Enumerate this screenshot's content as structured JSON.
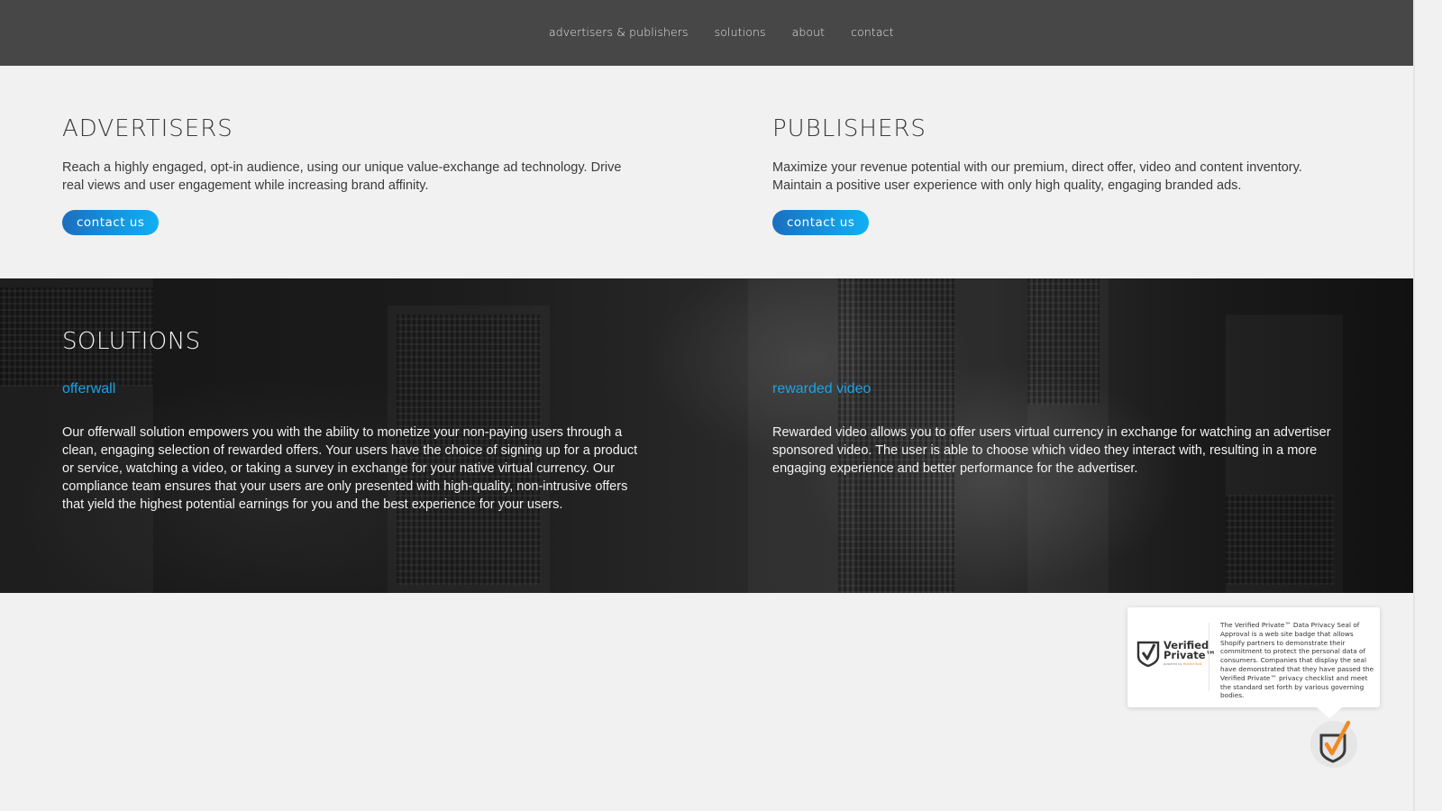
{
  "nav": {
    "items": [
      {
        "label": "advertisers & publishers"
      },
      {
        "label": "solutions"
      },
      {
        "label": "about"
      },
      {
        "label": "contact"
      }
    ]
  },
  "advertisers": {
    "title": "ADVERTISERS",
    "description": "Reach a highly engaged, opt-in audience, using our unique value-exchange ad technology. Drive real views and user engagement while increasing brand affinity.",
    "button_label": "contact us"
  },
  "publishers": {
    "title": "PUBLISHERS",
    "description": "Maximize your revenue potential with our premium, direct offer, video and content inventory. Maintain a positive user experience with only high quality, engaging branded ads.",
    "button_label": "contact us"
  },
  "solutions": {
    "title": "SOLUTIONS",
    "items": [
      {
        "title": "offerwall",
        "description": "Our offerwall solution empowers you with the ability to monetize your non-paying users through a clean, engaging selection of rewarded offers. Your users have the choice of signing up for a product or service, watching a video, or taking a survey in exchange for your native virtual currency. Our compliance team ensures that your users are only presented with high-quality, non-intrusive offers that yield the highest potential earnings for you and the best experience for your users."
      },
      {
        "title": "rewarded video",
        "description": "Rewarded video allows you to offer users virtual currency in exchange for watching an advertiser sponsored video. The user is able to choose which video they interact with, resulting in a more engaging experience and better performance for the advertiser."
      }
    ]
  },
  "verified_private": {
    "logo_line1": "Verified",
    "logo_line2": "Private™",
    "powered_by": "powered by",
    "powered_brand": "HiddenTrust",
    "description": "The Verified Private™ Data Privacy Seal of Approval is a web site badge that allows Shopify partners to demonstrate their commitment to protect the personal data of consumers. Companies that display the seal have demonstrated that they have passed the Verified Private™ privacy checklist and meet the standard set forth by various governing bodies.",
    "badge_icon": "shield-check-icon"
  },
  "colors": {
    "nav_bg": "#474747",
    "accent_blue": "#1aa3e8",
    "button_gradient_start": "#1a6fbf",
    "button_gradient_end": "#10b0f5",
    "badge_orange": "#f08a24"
  }
}
